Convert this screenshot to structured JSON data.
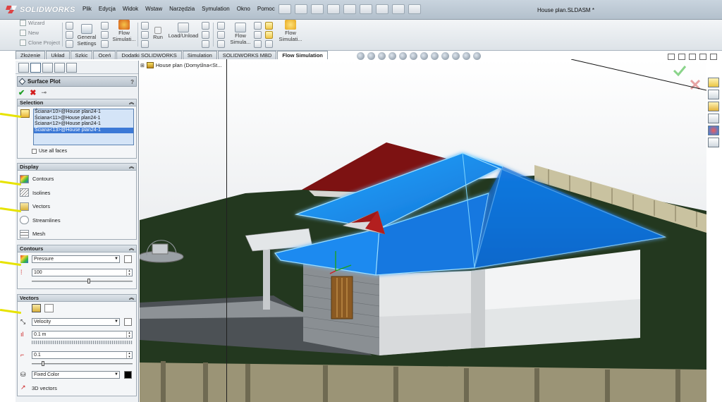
{
  "app": {
    "brand": "SOLIDWORKS",
    "menu": [
      "Plik",
      "Edycja",
      "Widok",
      "Wstaw",
      "Narzędzia",
      "Symulation",
      "Okno",
      "Pomoc"
    ],
    "doc_title": "House plan.SLDASM *"
  },
  "ribbon": {
    "wizard": "Wizard",
    "new": "New",
    "clone_project": "Clone Project",
    "general_settings": [
      "General",
      "Settings"
    ],
    "flow_sim_1": [
      "Flow",
      "Simulati..."
    ],
    "run": "Run",
    "load_unload": "Load/Unload",
    "flow_sim_2": [
      "Flow",
      "Simula..."
    ],
    "flow_sim_3": [
      "Flow",
      "Simulati..."
    ]
  },
  "tabs": [
    "Złożenie",
    "Układ",
    "Szkic",
    "Oceń",
    "Dodatki SOLIDWORKS",
    "Simulation",
    "SOLIDWORKS MBD",
    "Flow Simulation"
  ],
  "active_tab": "Flow Simulation",
  "tree": {
    "root": "House plan  (Domyślna<St..."
  },
  "panel": {
    "title": "Surface Plot",
    "help": "?",
    "selection": {
      "header": "Selection",
      "items": [
        "Ściana<10>@House plan24-1",
        "Ściana<11>@House plan24-1",
        "Ściana<12>@House plan24-1",
        "Ściana<13>@House plan24-1"
      ],
      "selected_index": 3,
      "use_all_faces": "Use all faces"
    },
    "display": {
      "header": "Display",
      "items": [
        "Contours",
        "Isolines",
        "Vectors",
        "Streamlines",
        "Mesh"
      ]
    },
    "contours": {
      "header": "Contours",
      "parameter": "Pressure",
      "levels": "100",
      "levels_slider": 0.55
    },
    "vectors": {
      "header": "Vectors",
      "parameter": "Velocity",
      "spacing": "0.1 m",
      "scale": "0.1",
      "scale_slider": 0.1,
      "color_mode": "Fixed Color",
      "three_d": "3D vectors"
    }
  },
  "colors": {
    "accent_blue": "#1f8ff0",
    "selection_bg": "#3c79d6",
    "ok_green": "#1e9e24",
    "cancel_red": "#d21d1d",
    "grass": "#24391f"
  },
  "icons": [
    "solidworks-logo-icon",
    "surface-plot-icon",
    "ok-check-icon",
    "cancel-x-icon",
    "pushpin-icon",
    "face-selection-icon",
    "contours-icon",
    "isolines-icon",
    "vectors-icon",
    "streamlines-icon",
    "mesh-icon",
    "color-swatch-icon"
  ]
}
